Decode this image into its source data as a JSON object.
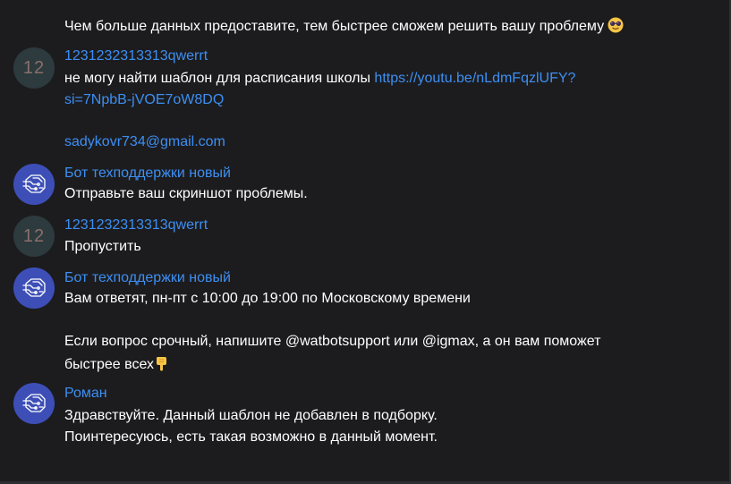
{
  "messages": [
    {
      "type": "continuation",
      "lines": [
        "Чем больше данных предоставите, тем быстрее сможем решить вашу проблему"
      ],
      "emoji": "sunglasses-face"
    },
    {
      "type": "user",
      "avatar_text": "12",
      "sender": "1231232313313qwerrt",
      "text_before_link": "не могу найти шаблон для расписания школы ",
      "link_part1": "https://youtu.be/nLdmFqzlUFY?",
      "link_part2": "si=7NpbB-jVOE7oW8DQ",
      "email": "sadykovr734@gmail.com"
    },
    {
      "type": "bot",
      "avatar_icon": "robot-head-icon",
      "sender": "Бот техподдержки новый",
      "lines": [
        "Отправьте ваш скриншот проблемы."
      ]
    },
    {
      "type": "user",
      "avatar_text": "12",
      "sender": "1231232313313qwerrt",
      "lines": [
        "Пропустить"
      ]
    },
    {
      "type": "bot",
      "avatar_icon": "robot-head-icon",
      "sender": "Бот техподдержки новый",
      "lines": [
        "Вам ответят, пн-пт с 10:00 до 19:00 по Московскому времени",
        "Если вопрос срочный, напишите @watbotsupport или @igmax, а он вам поможет",
        "быстрее всех"
      ],
      "emoji": "pointing-down-hand"
    },
    {
      "type": "agent",
      "avatar_icon": "robot-head-icon",
      "sender": "Роман",
      "lines": [
        "Здравствуйте. Данный шаблон не добавлен в подборку.",
        "Поинтересуюсь, есть такая возможно в данный момент."
      ]
    }
  ],
  "colors": {
    "background": "#1c1c1f",
    "link": "#3d8ff2",
    "bot_avatar": "#3d4fb7",
    "user_avatar": "#2d3a3e"
  }
}
